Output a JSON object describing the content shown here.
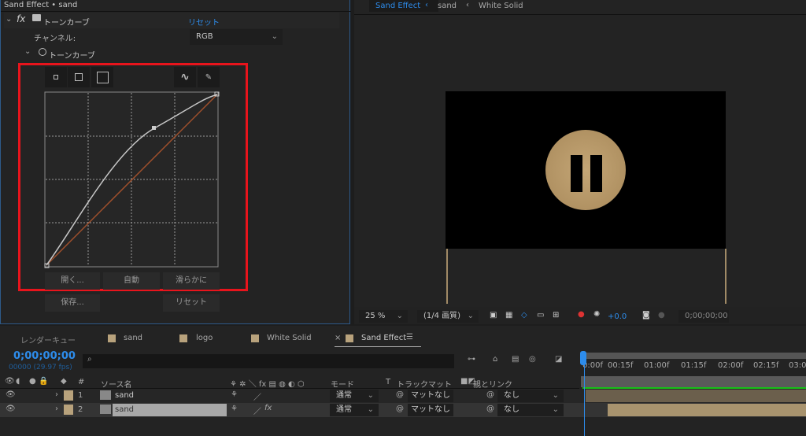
{
  "effect_panel": {
    "title": "Sand Effect • sand",
    "effect_name": "トーンカーブ",
    "reset": "リセット",
    "channel_label": "チャンネル:",
    "channel_value": "RGB",
    "curve_label": "トーンカーブ",
    "buttons": {
      "open": "開く...",
      "auto": "自動",
      "smooth": "滑らかに",
      "save": "保存...",
      "reset": "リセット"
    },
    "colors": {
      "curve": "#c8c8c8",
      "diagonal": "#a0502c",
      "highlight_box": "#e8141c"
    }
  },
  "viewer": {
    "breadcrumbs": [
      "Sand Effect",
      "sand",
      "White Solid"
    ],
    "zoom": "25 %",
    "quality": "(1/4 画質)",
    "exposure": "+0.0",
    "timecode": "0;00;00;00"
  },
  "timeline": {
    "tabs": [
      "レンダーキュー",
      "sand",
      "logo",
      "White Solid",
      "Sand Effect"
    ],
    "timecode": "0;00;00;00",
    "frames": "00000 (29.97 fps)",
    "columns": {
      "num": "#",
      "source": "ソース名",
      "mode": "モード",
      "t": "T",
      "matte": "トラックマット",
      "parent": "親とリンク"
    },
    "ruler": [
      "0:00f",
      "00:15f",
      "01:00f",
      "01:15f",
      "02:00f",
      "02:15f",
      "03:0"
    ],
    "layers": [
      {
        "num": "1",
        "name": "sand",
        "mode": "通常",
        "matte": "マットなし",
        "parent": "なし"
      },
      {
        "num": "2",
        "name": "sand",
        "mode": "通常",
        "matte": "マットなし",
        "parent": "なし",
        "fx": "fx"
      }
    ]
  }
}
